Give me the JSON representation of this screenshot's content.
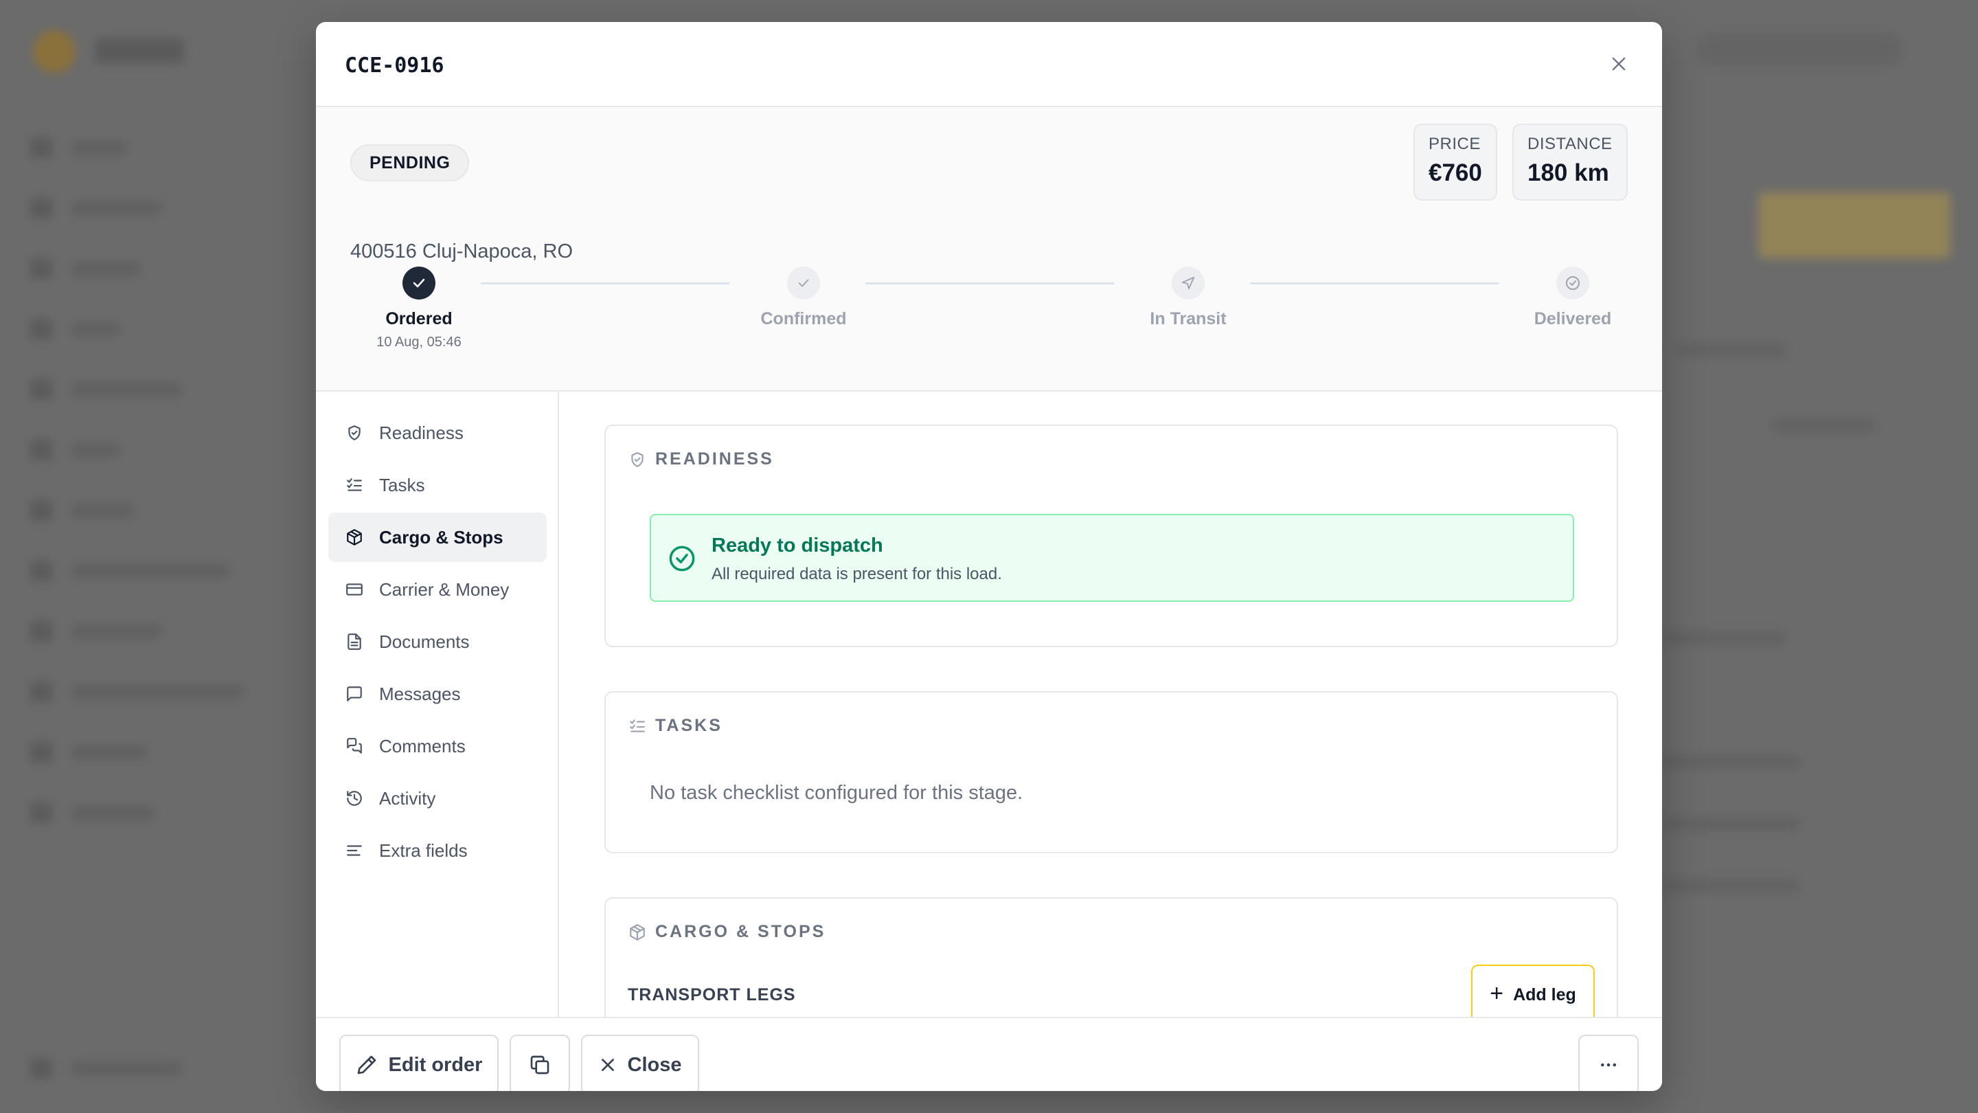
{
  "modal": {
    "title": "CCE-0916",
    "close_label": "close"
  },
  "summary": {
    "status": "PENDING",
    "price_label": "PRICE",
    "price_value": "€760",
    "distance_label": "DISTANCE",
    "distance_value": "180 km",
    "address": "400516 Cluj-Napoca, RO"
  },
  "steps": [
    {
      "label": "Ordered",
      "sub": "10 Aug, 05:46",
      "state": "done",
      "icon": "check-icon"
    },
    {
      "label": "Confirmed",
      "sub": "",
      "state": "todo",
      "icon": "check-icon"
    },
    {
      "label": "In Transit",
      "sub": "",
      "state": "todo",
      "icon": "navigation-icon"
    },
    {
      "label": "Delivered",
      "sub": "",
      "state": "todo",
      "icon": "check-circle-icon"
    }
  ],
  "sidebar": {
    "active_index": 2,
    "items": [
      {
        "label": "Readiness",
        "icon": "shield-check-icon"
      },
      {
        "label": "Tasks",
        "icon": "list-checks-icon"
      },
      {
        "label": "Cargo & Stops",
        "icon": "package-icon"
      },
      {
        "label": "Carrier & Money",
        "icon": "credit-card-icon"
      },
      {
        "label": "Documents",
        "icon": "file-text-icon"
      },
      {
        "label": "Messages",
        "icon": "message-square-icon"
      },
      {
        "label": "Comments",
        "icon": "messages-icon"
      },
      {
        "label": "Activity",
        "icon": "history-icon"
      },
      {
        "label": "Extra fields",
        "icon": "align-left-icon"
      }
    ]
  },
  "sections": {
    "readiness": {
      "title": "READINESS",
      "status_title": "Ready to dispatch",
      "status_text": "All required data is present for this load."
    },
    "tasks": {
      "title": "TASKS",
      "empty_text": "No task checklist configured for this stage."
    },
    "cargo": {
      "title": "CARGO & STOPS",
      "legs_label": "TRANSPORT LEGS",
      "add_leg_label": "Add leg"
    }
  },
  "footer": {
    "edit_label": "Edit order",
    "close_label": "Close"
  },
  "colors": {
    "success": "#047857",
    "success_bg": "#ecfdf3",
    "accent_border": "#facc15",
    "dark": "#1f2937"
  }
}
